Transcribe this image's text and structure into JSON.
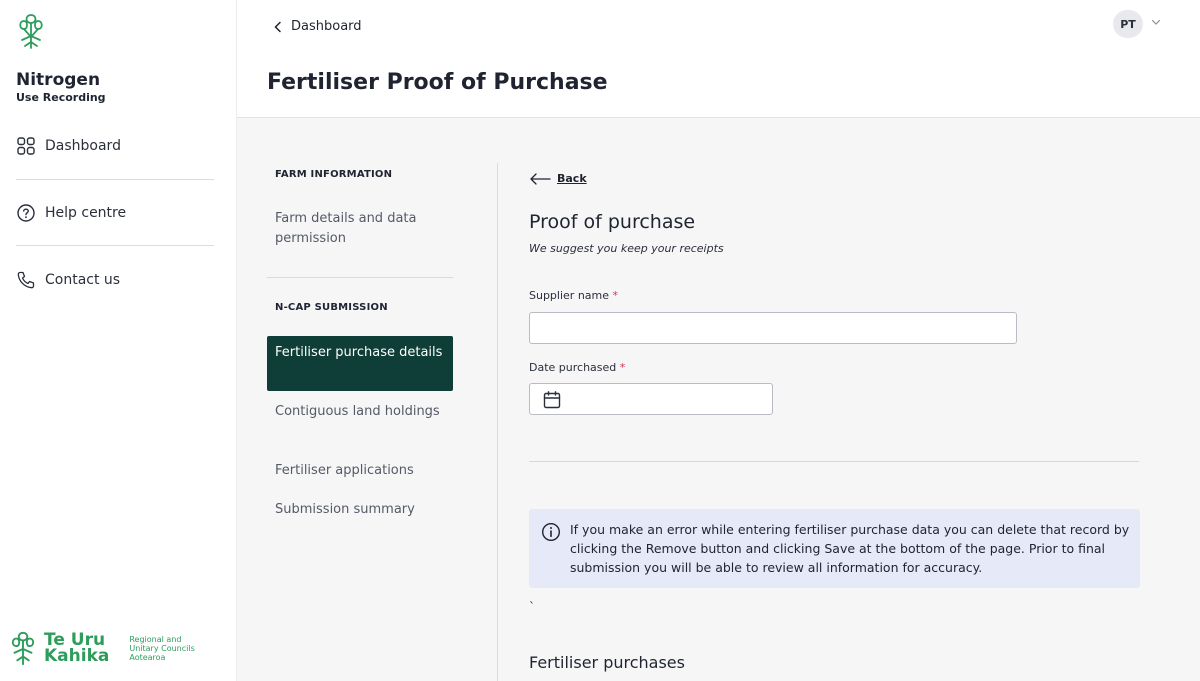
{
  "sidebar": {
    "brand_title": "Nitrogen",
    "brand_subtitle": "Use Recording",
    "items": [
      {
        "label": "Dashboard",
        "icon": "grid-icon"
      },
      {
        "label": "Help centre",
        "icon": "help-circle-icon"
      },
      {
        "label": "Contact us",
        "icon": "phone-icon"
      }
    ],
    "footer": {
      "logo_line1": "Te Uru",
      "logo_line2": "Kahika",
      "tagline_1": "Regional and",
      "tagline_2": "Unitary Councils",
      "tagline_3": "Aotearoa"
    }
  },
  "header": {
    "breadcrumb": "Dashboard",
    "title": "Fertiliser Proof of Purchase",
    "avatar_initials": "PT"
  },
  "steps": {
    "section1_heading": "FARM INFORMATION",
    "section1_items": [
      "Farm details and data permission"
    ],
    "section2_heading": "N-CAP SUBMISSION",
    "active_item": "Fertiliser purchase details",
    "section2_items": [
      "Contiguous land holdings",
      "Fertiliser applications",
      "Submission summary"
    ]
  },
  "form": {
    "back_label": "Back",
    "title": "Proof of purchase",
    "subtitle": "We suggest you keep your receipts",
    "supplier_label": "Supplier name",
    "required_marker": "*",
    "supplier_value": "",
    "date_label": "Date purchased",
    "info_text": "If you make an error while entering fertiliser purchase data you can delete that record by clicking the Remove button and clicking Save at the bottom of the page. Prior to final submission you will be able to review all information for accuracy.",
    "stray_char": "`",
    "purchases_title": "Fertiliser purchases"
  },
  "colors": {
    "active_step": "#0f3d37",
    "brand_green": "#2e9d5c",
    "info_bg": "#e5e9f8",
    "required": "#d6334b"
  }
}
